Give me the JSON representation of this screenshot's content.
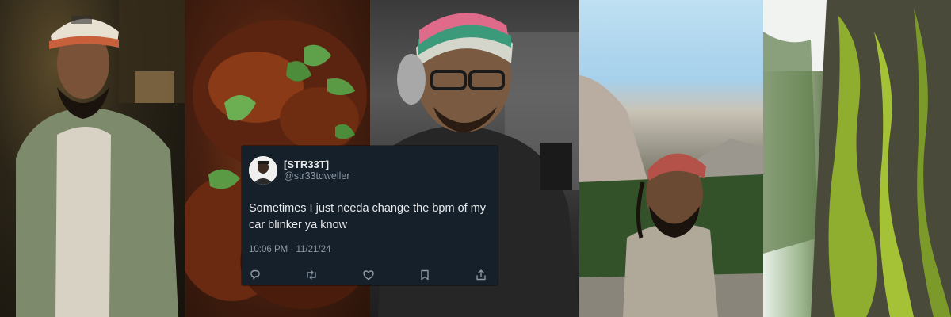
{
  "photos": [
    {
      "subject": "man in cap and jacket at night"
    },
    {
      "subject": "roasted chicken with mint"
    },
    {
      "subject": "man with headphones and beanie"
    },
    {
      "subject": "man in cap in mountain valley"
    },
    {
      "subject": "moss-covered tree trunk"
    }
  ],
  "tweet": {
    "display_name": "[STR33T]",
    "handle": "@str33tdweller",
    "text": "Sometimes I just needa change the bpm of my car blinker ya know",
    "timestamp": "10:06 PM · 11/21/24",
    "actions": [
      "reply-icon",
      "retweet-icon",
      "like-icon",
      "bookmark-icon",
      "share-icon"
    ]
  },
  "colors": {
    "card_bg": "#15202b",
    "text_primary": "#e7e9ea",
    "text_secondary": "#8b98a5"
  }
}
